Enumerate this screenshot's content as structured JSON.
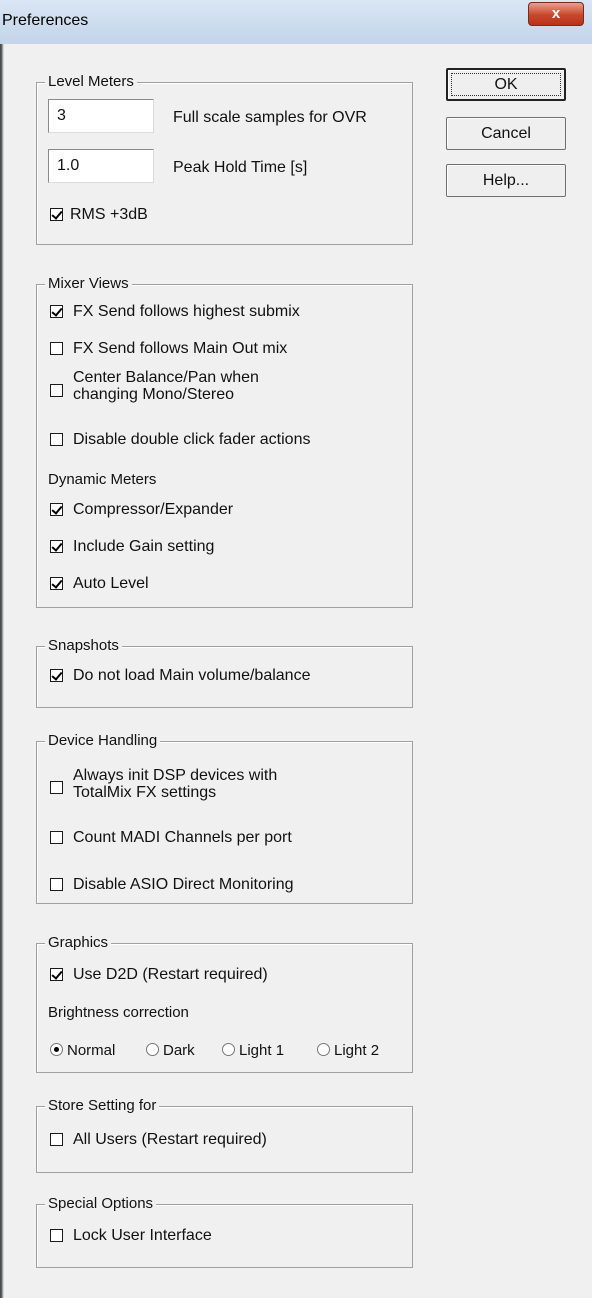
{
  "window": {
    "title": "Preferences",
    "close_label": "x"
  },
  "buttons": {
    "ok": "OK",
    "cancel": "Cancel",
    "help": "Help..."
  },
  "level_meters": {
    "legend": "Level Meters",
    "ovr_samples": {
      "value": "3",
      "label": "Full scale samples for OVR"
    },
    "peak_hold": {
      "value": "1.0",
      "label": "Peak Hold Time [s]"
    },
    "rms": {
      "label": "RMS +3dB",
      "checked": true
    }
  },
  "mixer_views": {
    "legend": "Mixer Views",
    "items": [
      {
        "label": "FX Send follows highest submix",
        "checked": true
      },
      {
        "label": "FX Send follows Main Out mix",
        "checked": false
      },
      {
        "label_line1": "Center Balance/Pan when",
        "label_line2": "changing Mono/Stereo",
        "checked": false
      },
      {
        "label": "Disable double click fader actions",
        "checked": false
      }
    ],
    "dynamic_meters_label": "Dynamic Meters",
    "dynamic_items": [
      {
        "label": "Compressor/Expander",
        "checked": true
      },
      {
        "label": "Include Gain setting",
        "checked": true
      },
      {
        "label": "Auto Level",
        "checked": true
      }
    ]
  },
  "snapshots": {
    "legend": "Snapshots",
    "item": {
      "label": "Do not load Main volume/balance",
      "checked": true
    }
  },
  "device_handling": {
    "legend": "Device Handling",
    "items": [
      {
        "label_line1": "Always init DSP devices with",
        "label_line2": "TotalMix FX settings",
        "checked": false
      },
      {
        "label": "Count MADI Channels per port",
        "checked": false
      },
      {
        "label": "Disable ASIO Direct Monitoring",
        "checked": false
      }
    ]
  },
  "graphics": {
    "legend": "Graphics",
    "d2d": {
      "label": "Use D2D (Restart required)",
      "checked": true
    },
    "brightness_label": "Brightness correction",
    "radios": [
      {
        "label": "Normal",
        "selected": true
      },
      {
        "label": "Dark",
        "selected": false
      },
      {
        "label": "Light 1",
        "selected": false
      },
      {
        "label": "Light 2",
        "selected": false
      }
    ]
  },
  "store_setting": {
    "legend": "Store Setting for",
    "item": {
      "label": "All Users (Restart required)",
      "checked": false
    }
  },
  "special_options": {
    "legend": "Special Options",
    "item": {
      "label": "Lock User Interface",
      "checked": false
    }
  }
}
